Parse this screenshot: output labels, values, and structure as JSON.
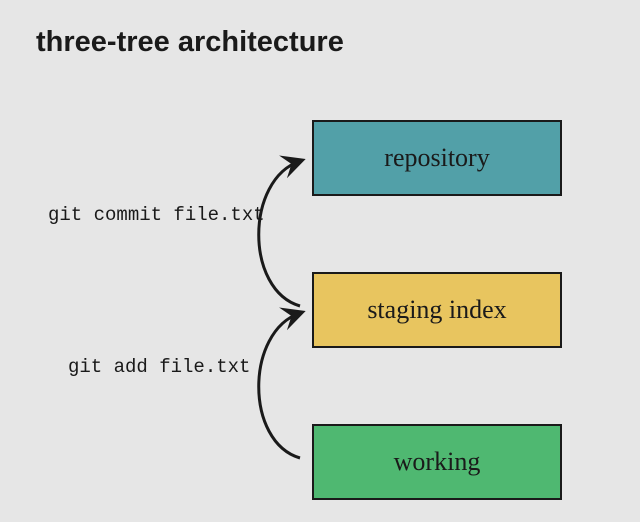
{
  "title": "three-tree architecture",
  "boxes": {
    "repository": "repository",
    "staging": "staging index",
    "working": "working"
  },
  "commands": {
    "commit": "git commit file.txt",
    "add": "git add file.txt"
  },
  "colors": {
    "repository": "#52a0a8",
    "staging": "#e8c55f",
    "working": "#4fb871",
    "border": "#1a1a1a",
    "background": "#e6e6e6"
  }
}
